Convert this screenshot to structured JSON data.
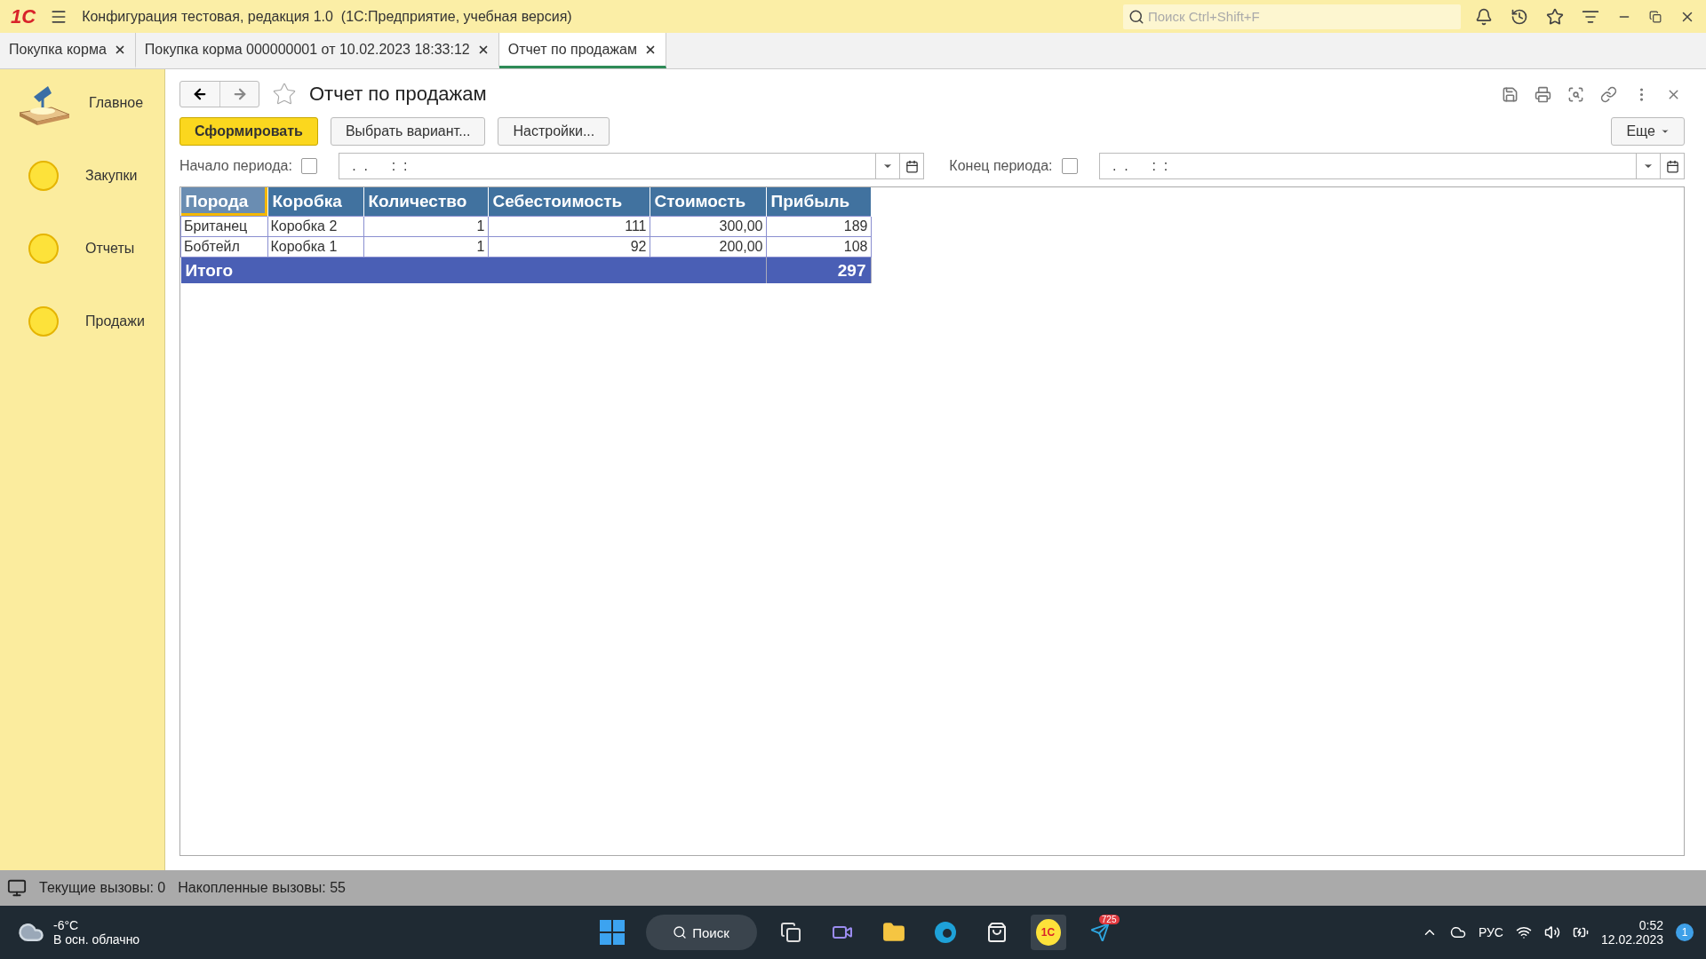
{
  "app": {
    "logo": "1С",
    "title": "Конфигурация тестовая, редакция 1.0  (1С:Предприятие, учебная версия)",
    "search": {
      "placeholder": "Поиск Ctrl+Shift+F"
    }
  },
  "tabs": [
    {
      "label": "Покупка корма",
      "selected": false
    },
    {
      "label": "Покупка корма 000000001 от 10.02.2023 18:33:12",
      "selected": false
    },
    {
      "label": "Отчет по продажам",
      "selected": true
    }
  ],
  "sidebar": {
    "items": [
      {
        "label": "Главное",
        "kind": "home"
      },
      {
        "label": "Закупки",
        "kind": "section"
      },
      {
        "label": "Отчеты",
        "kind": "section"
      },
      {
        "label": "Продажи",
        "kind": "section"
      }
    ]
  },
  "form": {
    "title": "Отчет по продажам",
    "buttons": [
      {
        "label": "Сформировать",
        "kind": "primary"
      },
      {
        "label": "Выбрать вариант...",
        "kind": "normal"
      },
      {
        "label": "Настройки...",
        "kind": "normal"
      }
    ],
    "more": "Еще",
    "period_start": {
      "label": "Начало периода:",
      "checked": false,
      "value": " .  .      :  :"
    },
    "period_end": {
      "label": "Конец периода:",
      "checked": false,
      "value": " .  .      :  :"
    }
  },
  "report": {
    "columns": [
      {
        "label": "Порода",
        "selected": true,
        "kind": "text"
      },
      {
        "label": "Коробка",
        "selected": false,
        "kind": "text"
      },
      {
        "label": "Количество",
        "selected": false,
        "kind": "number"
      },
      {
        "label": "Себестоимость",
        "selected": false,
        "kind": "number"
      },
      {
        "label": "Стоимость",
        "selected": false,
        "kind": "number"
      },
      {
        "label": "Прибыль",
        "selected": false,
        "kind": "number"
      }
    ],
    "rows": [
      [
        "Британец",
        "Коробка 2",
        "1",
        "111",
        "300,00",
        "189"
      ],
      [
        "Бобтейл",
        "Коробка 1",
        "1",
        "92",
        "200,00",
        "108"
      ]
    ],
    "total": {
      "label": "Итого",
      "value": "297"
    }
  },
  "status_bar": {
    "current_calls": "Текущие вызовы: 0",
    "accumulated_calls": "Накопленные вызовы: 55"
  },
  "taskbar": {
    "temperature": "-6°C",
    "weather": "В осн. облачно",
    "search": "Поиск",
    "app_icon_label": "1С",
    "telegram_badge": "725",
    "language": "РУС",
    "time": "0:52",
    "date": "12.02.2023",
    "notifications": "1"
  }
}
